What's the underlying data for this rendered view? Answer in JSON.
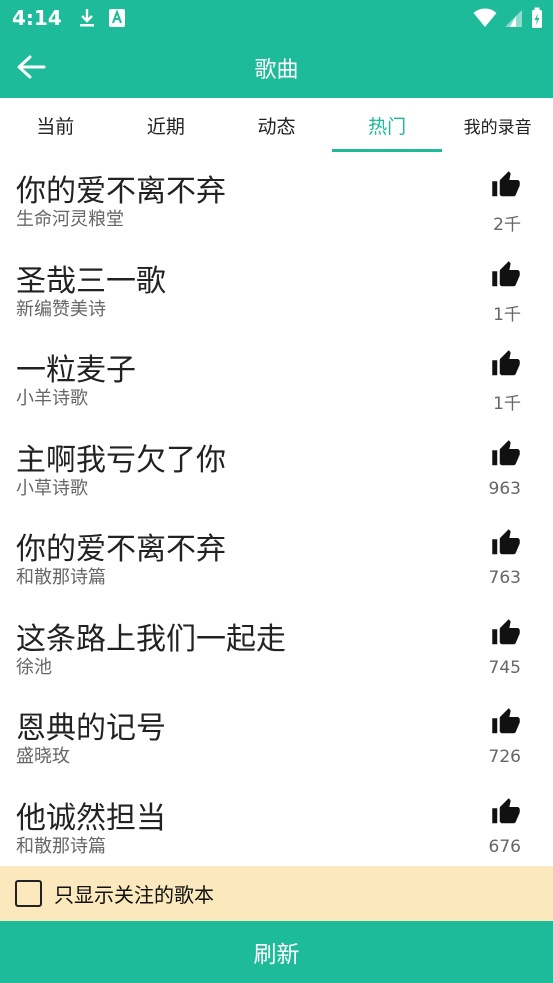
{
  "status_bar": {
    "time": "4:14"
  },
  "app_bar": {
    "title": "歌曲"
  },
  "tabs": [
    {
      "label": "当前"
    },
    {
      "label": "近期"
    },
    {
      "label": "动态"
    },
    {
      "label": "热门",
      "active": true
    },
    {
      "label": "我的录音"
    }
  ],
  "songs": [
    {
      "title": "你的爱不离不弃",
      "source": "生命河灵粮堂",
      "likes": "2千"
    },
    {
      "title": "圣哉三一歌",
      "source": "新编赞美诗",
      "likes": "1千"
    },
    {
      "title": "一粒麦子",
      "source": "小羊诗歌",
      "likes": "1千"
    },
    {
      "title": "主啊我亏欠了你",
      "source": "小草诗歌",
      "likes": "963"
    },
    {
      "title": "你的爱不离不弃",
      "source": "和散那诗篇",
      "likes": "763"
    },
    {
      "title": "这条路上我们一起走",
      "source": "徐池",
      "likes": "745"
    },
    {
      "title": "恩典的记号",
      "source": "盛晓玫",
      "likes": "726"
    },
    {
      "title": "他诚然担当",
      "source": "和散那诗篇",
      "likes": "676"
    }
  ],
  "filter": {
    "label": "只显示关注的歌本",
    "checked": false
  },
  "refresh_button": {
    "label": "刷新"
  },
  "colors": {
    "accent": "#1dbb99",
    "filter_bg": "#fbe9bd"
  }
}
